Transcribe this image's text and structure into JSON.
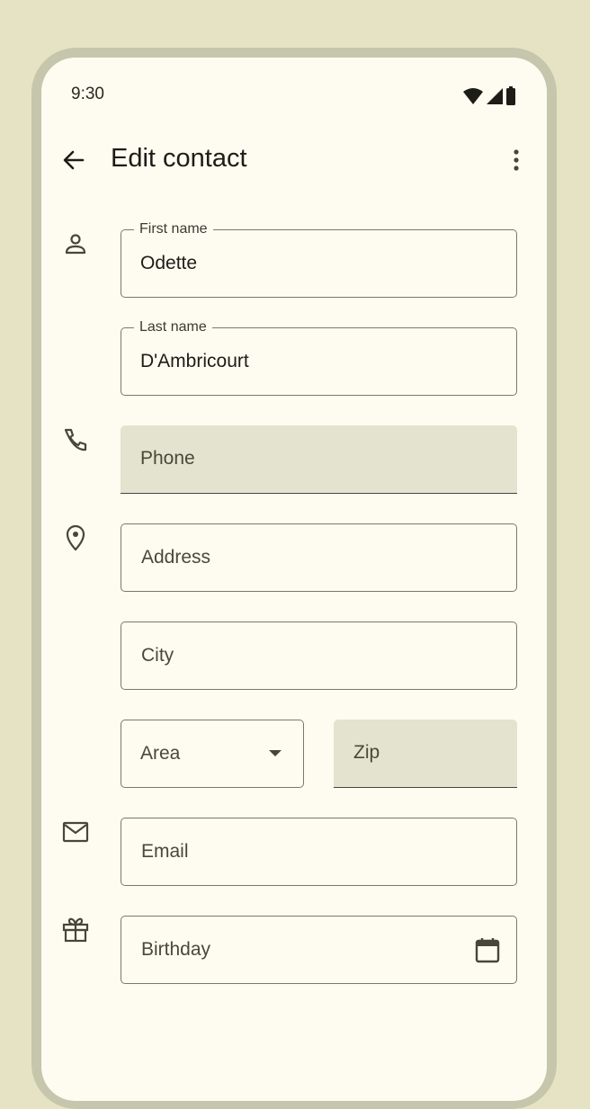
{
  "status_bar": {
    "time": "9:30"
  },
  "app_bar": {
    "title": "Edit contact"
  },
  "form": {
    "first_name": {
      "label": "First name",
      "value": "Odette"
    },
    "last_name": {
      "label": "Last name",
      "value": "D'Ambricourt"
    },
    "phone": {
      "placeholder": "Phone"
    },
    "address": {
      "placeholder": "Address"
    },
    "city": {
      "placeholder": "City"
    },
    "area": {
      "selected": "Area"
    },
    "zip": {
      "placeholder": "Zip"
    },
    "email": {
      "placeholder": "Email"
    },
    "birthday": {
      "placeholder": "Birthday"
    }
  },
  "icons": {
    "back": "arrow-back-icon",
    "more": "more-vert-icon",
    "person": "person-icon",
    "phone": "phone-icon",
    "location": "location-pin-icon",
    "email": "mail-icon",
    "birthday": "gift-icon",
    "calendar": "calendar-icon"
  },
  "colors": {
    "background": "#e6e3c4",
    "frame": "#c6c6ad",
    "surface": "#fefcf1",
    "filled_field": "#e4e3d0",
    "outline": "#7a7968",
    "text": "#1d1c16"
  }
}
